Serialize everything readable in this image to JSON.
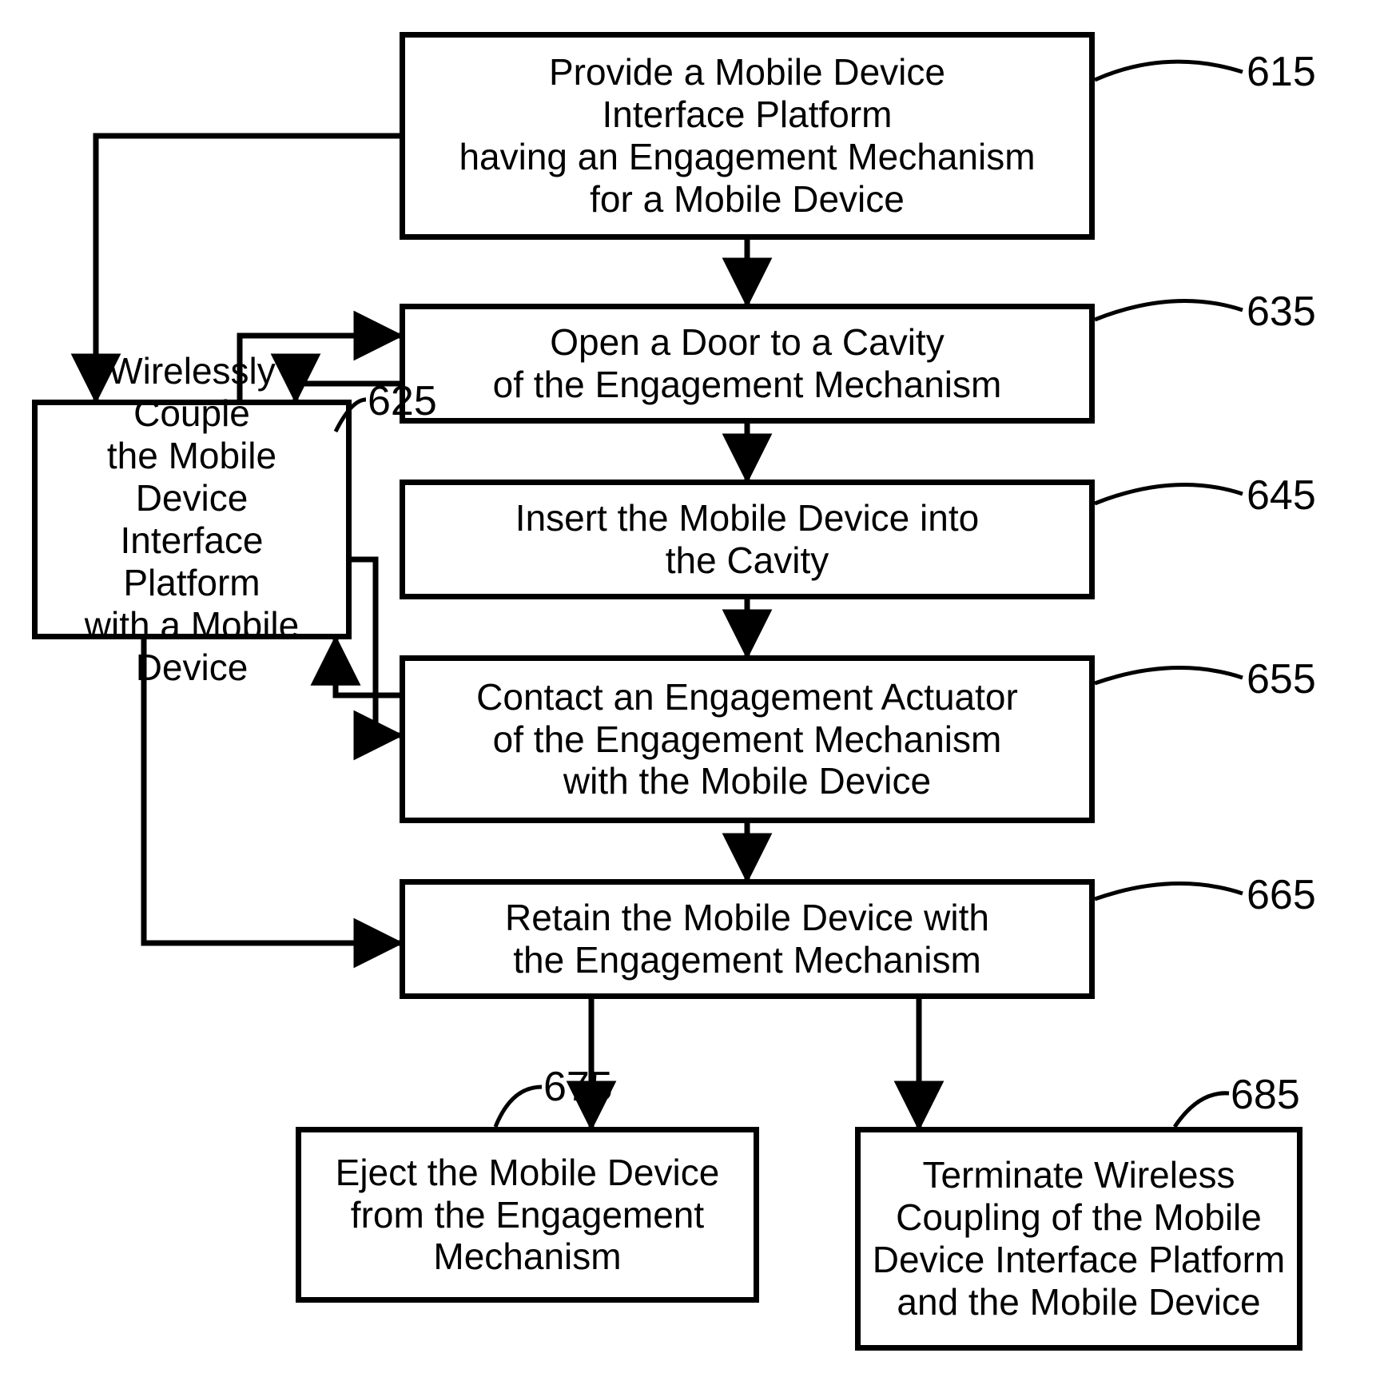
{
  "boxes": {
    "b615": "Provide a Mobile Device\nInterface Platform\nhaving an Engagement Mechanism\nfor a Mobile Device",
    "b625": "Wirelessly Couple\nthe Mobile Device\nInterface Platform\nwith a Mobile Device",
    "b635": "Open a Door to a Cavity\nof the Engagement Mechanism",
    "b645": "Insert the Mobile Device into\nthe Cavity",
    "b655": "Contact an Engagement Actuator\nof the Engagement Mechanism\nwith the Mobile Device",
    "b665": "Retain the Mobile Device with\nthe Engagement Mechanism",
    "b675": "Eject the Mobile Device\nfrom the Engagement\nMechanism",
    "b685": "Terminate Wireless\nCoupling of the Mobile\nDevice Interface Platform\nand the Mobile Device"
  },
  "labels": {
    "l615": "615",
    "l625": "625",
    "l635": "635",
    "l645": "645",
    "l655": "655",
    "l665": "665",
    "l675": "675",
    "l685": "685"
  }
}
